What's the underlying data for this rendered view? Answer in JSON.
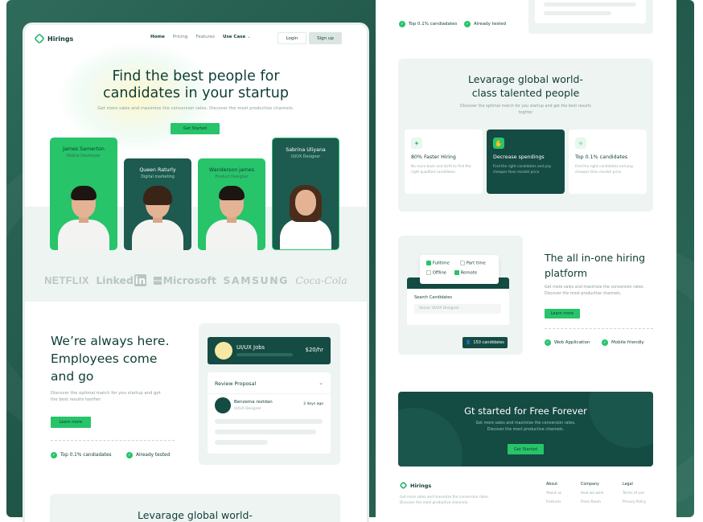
{
  "left": {
    "nav": {
      "brand": "Hirings",
      "menu": [
        "Home",
        "Pricing",
        "Features",
        "Use Case"
      ],
      "login": "Login",
      "signup": "Sign up"
    },
    "hero": {
      "title_line1": "Find the best people for",
      "title_line2": "candidates in your startup",
      "subtitle": "Get more sales and maximize the conversion rates. Discover the most productive channels.",
      "cta": "Get Started"
    },
    "people": [
      {
        "name": "James Samerton",
        "role": "Mobile Developer"
      },
      {
        "name": "Queen Raturly",
        "role": "Digital marketing"
      },
      {
        "name": "Wanderson james",
        "role": "Product Designer"
      },
      {
        "name": "Sabrina Uliyana",
        "role": "UI/UX Designer"
      }
    ],
    "logos": [
      "NETFLIX",
      "Linked",
      "in",
      "Microsoft",
      "SAMSUNG",
      "Coca-Cola"
    ],
    "section2": {
      "title_line1": "We’re always here.",
      "title_line2": "Employees come",
      "title_line3": "and go",
      "subtitle": "Discover the optimal match for you startup and get the best results toother",
      "cta": "Learn more",
      "check1": "Top 0.1% candiadates",
      "check2": "Already tested"
    },
    "job_card": {
      "title": "UI/UX Jobs",
      "rate": "$20/hr"
    },
    "review": {
      "title": "Review Proposal",
      "name": "Benzema rezidan",
      "role": "UI/UX Designer",
      "time": "2 days ago"
    },
    "peek_title": "Levarage global world-"
  },
  "right": {
    "top_checks": [
      "Top 0.1% candiadates",
      "Already tested"
    ],
    "leverage": {
      "title_line1": "Levarage global world-",
      "title_line2": "class talented people",
      "subtitle_line1": "Discover the optimal match for you startup and get the best results",
      "subtitle_line2": "toghter",
      "cards": [
        {
          "title": "80% Faster Hiring",
          "desc": "No more back and forth to find the right qualified candidates"
        },
        {
          "title": "Decrease spendings",
          "desc": "Find the right candidates and pay cheaper than market price"
        },
        {
          "title": "Top 0.1% candidates",
          "desc": "Find the right candidates and pay cheaper than market price"
        }
      ]
    },
    "filters": [
      {
        "label": "Fulltime",
        "checked": true
      },
      {
        "label": "Part time",
        "checked": false
      },
      {
        "label": "Offline",
        "checked": false
      },
      {
        "label": "Remote",
        "checked": true
      }
    ],
    "search": {
      "label": "Search Candidates",
      "placeholder": "Senior UI/UX Designer"
    },
    "candidates_badge": "150 candidates",
    "allinone": {
      "title_line1": "The all in-one hiring",
      "title_line2": "platform",
      "subtitle": "Get more sales and maximize the conversion rates. Discover the most productive channels.",
      "cta": "Learn more",
      "check1": "Web Application",
      "check2": "Mobile friendly"
    },
    "cta_banner": {
      "title": "Gt started for Free Forever",
      "subtitle": "Get more sales and maximize the conversion rates. Discover the most productive channels.",
      "cta": "Get Started"
    },
    "footer": {
      "brand": "Hirings",
      "tagline": "Get more sales and maximize the conversion rates. Discover the most productive channels.",
      "cols": [
        {
          "title": "About",
          "links": [
            "About us",
            "Features"
          ]
        },
        {
          "title": "Company",
          "links": [
            "How we work",
            "Press Room"
          ]
        },
        {
          "title": "Legal",
          "links": [
            "Terms of use",
            "Privacy Policy"
          ]
        }
      ]
    }
  },
  "colors": {
    "dark_green": "#144b43",
    "accent_green": "#27c46a",
    "text": "#0f3d36",
    "muted": "#8a9c98",
    "panel": "#eef4f2"
  }
}
